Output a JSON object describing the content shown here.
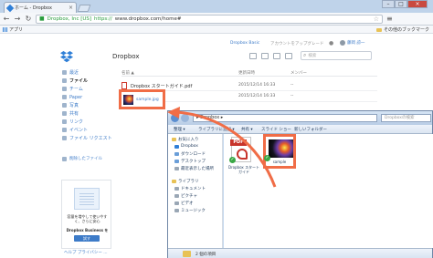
{
  "browser": {
    "tab_title": "ホーム - Dropbox",
    "tab_close": "×",
    "window_buttons": [
      "–",
      "□",
      "×"
    ],
    "nav": {
      "back": "←",
      "forward": "→",
      "reload": "↻"
    },
    "address": {
      "secure_label": "Dropbox, Inc [US]",
      "url_scheme": "https://",
      "url_rest": "www.dropbox.com/home#"
    },
    "bookmarks": {
      "apps": "アプリ",
      "other": "その他のブックマーク"
    },
    "menu_icon": "≡"
  },
  "dropbox": {
    "title": "Dropbox",
    "upgrade_link": "Dropbox Basic",
    "account_link": "アカウントをアップグレード",
    "user_name": "藤岡 諒一",
    "search_placeholder": "検索",
    "sidebar": [
      {
        "label": "最近",
        "active": false
      },
      {
        "label": "ファイル",
        "active": true
      },
      {
        "label": "チーム",
        "active": false
      },
      {
        "label": "Paper",
        "active": false
      },
      {
        "label": "写真",
        "active": false
      },
      {
        "label": "共有",
        "active": false
      },
      {
        "label": "リンク",
        "active": false
      },
      {
        "label": "イベント",
        "active": false
      },
      {
        "label": "ファイル リクエスト",
        "active": false
      }
    ],
    "deleted_files": "削除したファイル",
    "promo": {
      "text": "容量を増やして使いやすく、さらに安心",
      "title": "Dropbox Business を",
      "button": "試す"
    },
    "footer": "ヘルプ  プライバシー  ...",
    "columns": {
      "name": "名前 ▲",
      "modified": "更新日時",
      "members": "メンバー"
    },
    "files": [
      {
        "name": "Dropbox スタートガイド.pdf",
        "modified": "2015/12/14 16:33",
        "kind": "--"
      },
      {
        "name": "sample.jpg",
        "modified": "2015/12/14 16:33",
        "kind": "--"
      }
    ]
  },
  "explorer": {
    "address": "▸ Dropbox ▸",
    "search_placeholder": "Dropboxの検索",
    "commands": [
      "整理 ▾",
      "ライブラリに追加 ▾",
      "共有 ▾",
      "スライド ショー",
      "新しいフォルダー"
    ],
    "nav_items": [
      {
        "label": "お気に入り",
        "color": "#e8c256"
      },
      {
        "label": "Dropbox",
        "color": "#2f7fd7"
      },
      {
        "label": "ダウンロード",
        "color": "#6a9ed8"
      },
      {
        "label": "デスクトップ",
        "color": "#6a9ed8"
      },
      {
        "label": "最近表示した場所",
        "color": "#9aa7b5"
      },
      {
        "label": "ライブラリ",
        "color": "#e8c256"
      },
      {
        "label": "ドキュメント",
        "color": "#9aa7b5"
      },
      {
        "label": "ピクチャ",
        "color": "#9aa7b5"
      },
      {
        "label": "ビデオ",
        "color": "#9aa7b5"
      },
      {
        "label": "ミュージック",
        "color": "#9aa7b5"
      }
    ],
    "files": [
      {
        "name": "Dropbox スタートガイド",
        "icon": "pdf-icon",
        "banner": "PDF"
      },
      {
        "name": "sample",
        "icon": "image-icon"
      }
    ],
    "check": "✓",
    "status": "2 個の項目"
  },
  "colors": {
    "highlight": "#f06d47",
    "link": "#3d7bc8",
    "synced": "#39a845"
  }
}
